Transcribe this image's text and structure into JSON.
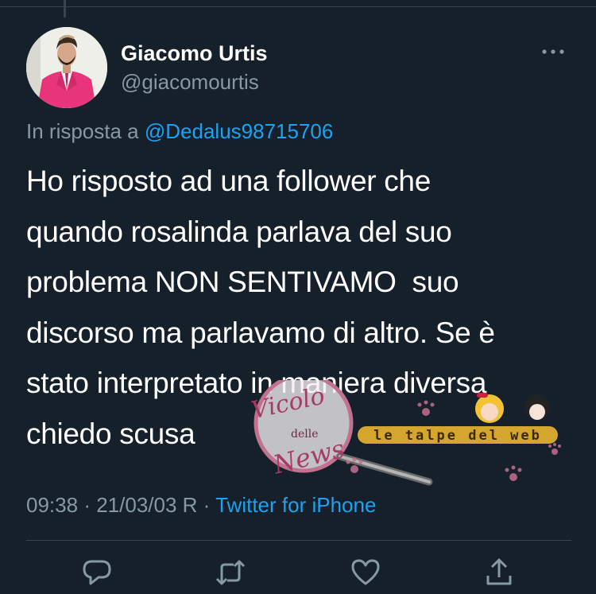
{
  "author": {
    "display_name": "Giacomo Urtis",
    "handle": "@giacomourtis"
  },
  "reply": {
    "prefix": "In risposta a",
    "mention": "@Dedalus98715706"
  },
  "tweet": {
    "text": "Ho risposto ad una follower che\nquando rosalinda parlava del suo\nproblema NON SENTIVAMO  suo\ndiscorso ma parlavamo di altro. Se è\nstato interpretato in maniera diversa\nchiedo scusa"
  },
  "meta": {
    "time": "09:38",
    "date": "21/03/03 R",
    "separator": "·",
    "source": "Twitter for iPhone"
  },
  "watermark": {
    "logo_text_1": "Vicolo",
    "logo_text_2": "delle",
    "logo_text_3": "News",
    "banner": "le talpe del web"
  },
  "icons": {
    "reply": "reply-icon",
    "retweet": "retweet-icon",
    "like": "heart-icon",
    "share": "share-icon",
    "more": "more-icon"
  },
  "colors": {
    "background": "#15202b",
    "text": "#ffffff",
    "secondary": "#8899a6",
    "accent": "#1da1f2"
  }
}
